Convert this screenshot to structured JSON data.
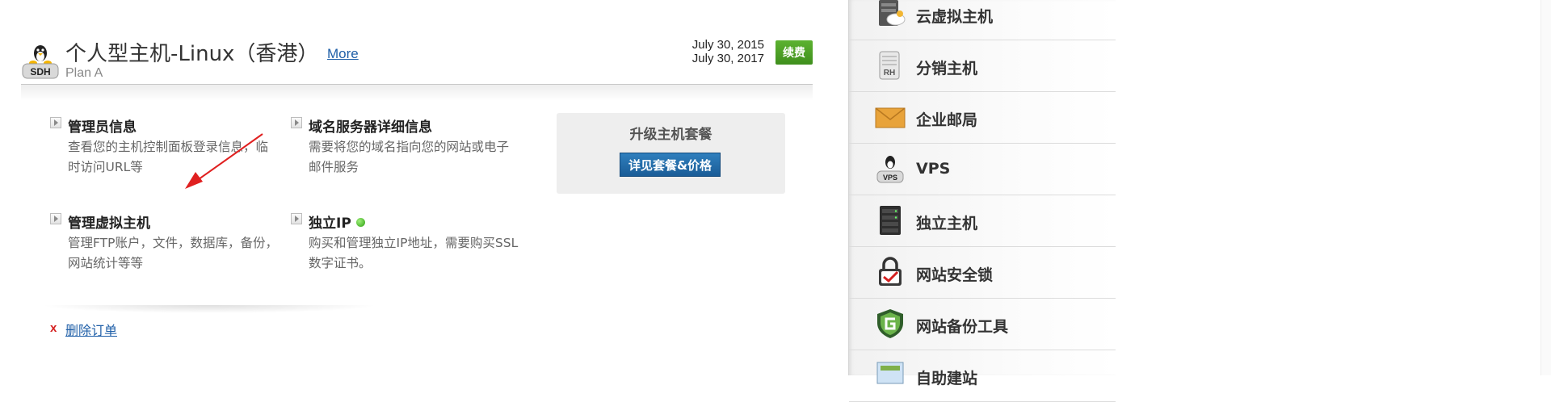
{
  "plan": {
    "logo_text": "SDH",
    "title": "个人型主机-Linux（香港）",
    "more_label": "More",
    "subtitle": "Plan A",
    "date_start": "July 30, 2015",
    "date_end": "July 30, 2017",
    "renew_label": "续费"
  },
  "actions": [
    {
      "title": "管理员信息",
      "desc": "查看您的主机控制面板登录信息，临时访问URL等"
    },
    {
      "title": "域名服务器详细信息",
      "desc": "需要将您的域名指向您的网站或电子邮件服务"
    },
    {
      "title": "管理虚拟主机",
      "desc": "管理FTP账户，文件，数据库，备份，网站统计等等"
    },
    {
      "title": "独立IP",
      "desc": "购买和管理独立IP地址，需要购买SSL数字证书。"
    }
  ],
  "upgrade": {
    "title": "升级主机套餐",
    "button_label": "详见套餐&价格"
  },
  "delete": {
    "x_label": "x",
    "link_label": "删除订单"
  },
  "sidebar": {
    "items": [
      {
        "label": "云虚拟主机",
        "icon": "cloud-server-icon"
      },
      {
        "label": "分销主机",
        "icon": "reseller-server-icon",
        "icon_text": "RH"
      },
      {
        "label": "企业邮局",
        "icon": "envelope-icon"
      },
      {
        "label": "VPS",
        "icon": "linux-vps-icon",
        "icon_text": "VPS"
      },
      {
        "label": "独立主机",
        "icon": "dedicated-server-icon"
      },
      {
        "label": "网站安全锁",
        "icon": "security-lock-icon"
      },
      {
        "label": "网站备份工具",
        "icon": "backup-shield-icon"
      },
      {
        "label": "自助建站",
        "icon": "site-builder-icon"
      }
    ]
  },
  "colors": {
    "link": "#1f5fa8",
    "renew_green": "#4a9f22",
    "upgrade_blue": "#1f6aa8",
    "annotation_red": "#e02020"
  }
}
